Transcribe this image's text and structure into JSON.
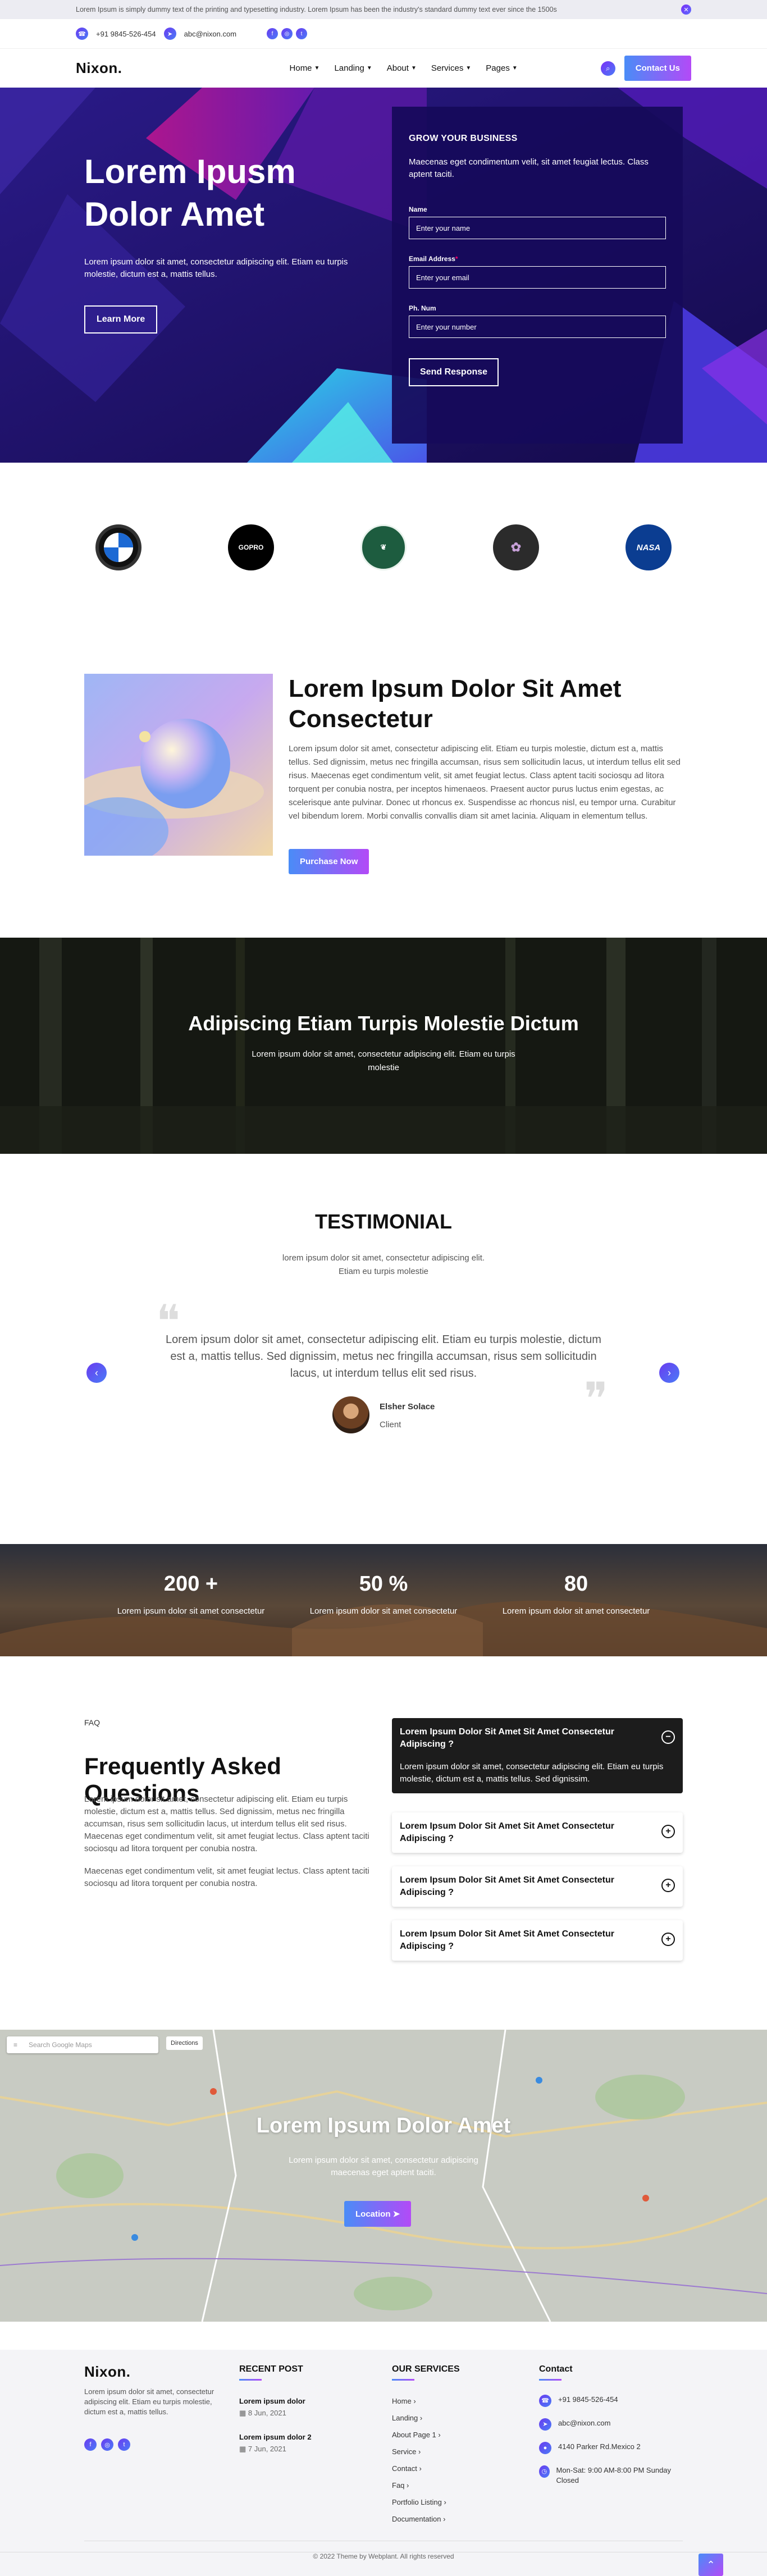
{
  "notice": {
    "text": "Lorem Ipsum is simply dummy text of the printing and typesetting industry. Lorem Ipsum has been the industry's standard dummy text ever since the 1500s",
    "close_icon": "close-icon"
  },
  "contact": {
    "phone": "+91 9845-526-454",
    "email": "abc@nixon.com"
  },
  "brand": {
    "logo": "Nixon.",
    "accent": "#6a3bf0",
    "gradient_from": "#4a8cf7",
    "gradient_to": "#b34af7"
  },
  "nav": {
    "items": [
      "Home",
      "Landing",
      "About",
      "Services",
      "Pages"
    ],
    "cta": "Contact Us"
  },
  "hero": {
    "title": "Lorem Ipusm Dolor Amet",
    "subtitle": "Lorem ipsum dolor sit amet, consectetur adipiscing elit. Etiam eu turpis molestie, dictum est a, mattis tellus.",
    "button": "Learn More",
    "form": {
      "heading": "GROW YOUR BUSINESS",
      "text": "Maecenas eget condimentum velit, sit amet feugiat lectus. Class aptent taciti.",
      "name_label": "Name",
      "name_placeholder": "Enter your name",
      "email_label": "Email Address",
      "email_required": "*",
      "email_placeholder": "Enter your email",
      "phone_label": "Ph. Num",
      "phone_placeholder": "Enter your number",
      "submit": "Send Response"
    }
  },
  "logos": [
    "BMW",
    "GOPRO",
    "GREEN",
    "BRAND",
    "NASA"
  ],
  "about": {
    "title": "Lorem Ipsum Dolor Sit Amet Consectetur",
    "text": "Lorem ipsum dolor sit amet, consectetur adipiscing elit. Etiam eu turpis molestie, dictum est a, mattis tellus. Sed dignissim, metus nec fringilla accumsan, risus sem sollicitudin lacus, ut interdum tellus elit sed risus. Maecenas eget condimentum velit, sit amet feugiat lectus. Class aptent taciti sociosqu ad litora torquent per conubia nostra, per inceptos himenaeos. Praesent auctor purus luctus enim egestas, ac scelerisque ante pulvinar. Donec ut rhoncus ex. Suspendisse ac rhoncus nisl, eu tempor urna. Curabitur vel bibendum lorem. Morbi convallis convallis diam sit amet lacinia. Aliquam in elementum tellus.",
    "button": "Purchase Now"
  },
  "banner": {
    "title": "Adipiscing Etiam Turpis Molestie Dictum",
    "text": "Lorem ipsum dolor sit amet, consectetur adipiscing elit. Etiam eu turpis molestie"
  },
  "testimonial": {
    "heading": "TESTIMONIAL",
    "subheading": "lorem ipsum dolor sit amet, consectetur adipiscing elit. Etiam eu turpis molestie",
    "quote": "Lorem ipsum dolor sit amet, consectetur adipiscing elit. Etiam eu turpis molestie, dictum est a, mattis tellus. Sed dignissim, metus nec fringilla accumsan, risus sem sollicitudin lacus, ut interdum tellus elit sed risus.",
    "name": "Elsher Solace",
    "role": "Client"
  },
  "stats": [
    {
      "value": "200 +",
      "label": "Lorem ipsum dolor sit amet consectetur"
    },
    {
      "value": "50 %",
      "label": "Lorem ipsum dolor sit amet consectetur"
    },
    {
      "value": "80",
      "label": "Lorem ipsum dolor sit amet consectetur"
    }
  ],
  "faq": {
    "tag": "FAQ",
    "title": "Frequently Asked Questions",
    "p1": "Lorem ipsum dolor sit amet, consectetur adipiscing elit. Etiam eu turpis molestie, dictum est a, mattis tellus. Sed dignissim, metus nec fringilla accumsan, risus sem sollicitudin lacus, ut interdum tellus elit sed risus. Maecenas eget condimentum velit, sit amet feugiat lectus. Class aptent taciti sociosqu ad litora torquent per conubia nostra.",
    "p2": "Maecenas eget condimentum velit, sit amet feugiat lectus. Class aptent taciti sociosqu ad litora torquent per conubia nostra.",
    "items": [
      {
        "q": "Lorem Ipsum Dolor Sit Amet Sit Amet Consectetur Adipiscing ?",
        "a": "Lorem ipsum dolor sit amet, consectetur adipiscing elit. Etiam eu turpis molestie, dictum est a, mattis tellus. Sed dignissim."
      },
      {
        "q": "Lorem Ipsum Dolor Sit Amet Sit Amet Consectetur Adipiscing ?"
      },
      {
        "q": "Lorem Ipsum Dolor Sit Amet Sit Amet Consectetur Adipiscing ?"
      },
      {
        "q": "Lorem Ipsum Dolor Sit Amet Sit Amet Consectetur Adipiscing ?"
      }
    ]
  },
  "map": {
    "search_placeholder": "Search Google Maps",
    "directions": "Directions",
    "title": "Lorem Ipsum Dolor Amet",
    "text": "Lorem ipsum dolor sit amet, consectetur adipiscing maecenas eget aptent taciti.",
    "button": "Location"
  },
  "footer": {
    "logo": "Nixon.",
    "desc": "Lorem ipsum dolor sit amet, consectetur adipiscing elit. Etiam eu turpis molestie, dictum est a, mattis tellus.",
    "recent_heading": "RECENT POST",
    "posts": [
      {
        "title": "Lorem ipsum dolor",
        "date": "8 Jun, 2021"
      },
      {
        "title": "Lorem ipsum dolor 2",
        "date": "7 Jun, 2021"
      }
    ],
    "services_heading": "OUR SERVICES",
    "services": [
      "Home",
      "Landing",
      "About Page 1",
      "Service",
      "Contact",
      "Faq",
      "Portfolio Listing",
      "Documentation"
    ],
    "contact_heading": "Contact",
    "contact": [
      "+91 9845-526-454",
      "abc@nixon.com",
      "4140 Parker Rd.Mexico 2",
      "Mon-Sat: 9:00 AM-8:00 PM Sunday Closed"
    ],
    "copyright": "© 2022 Theme by Webplant. All rights reserved"
  }
}
